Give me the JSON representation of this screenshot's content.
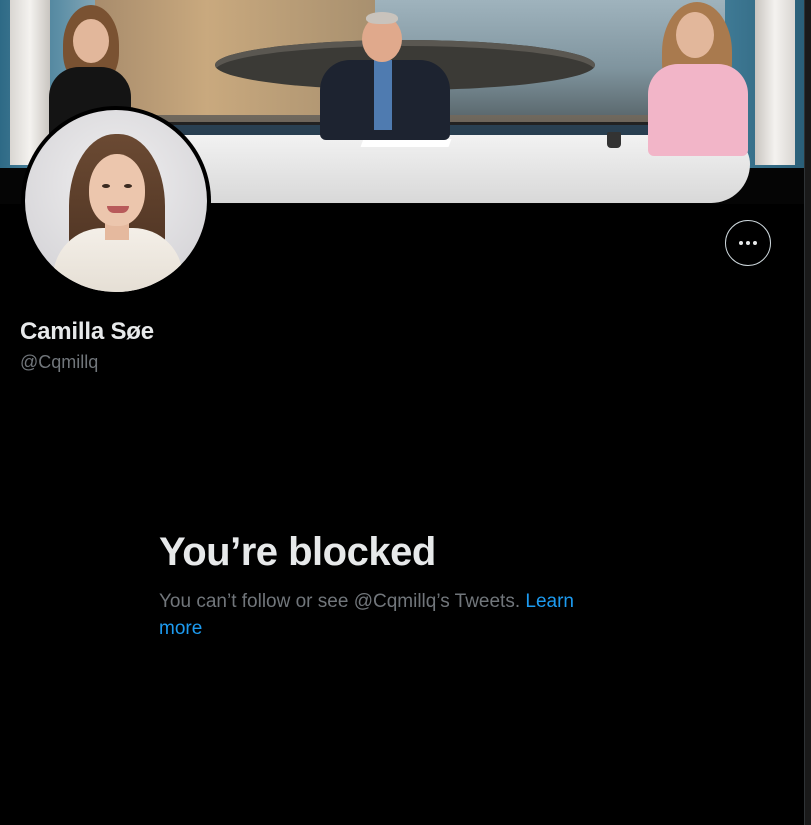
{
  "profile": {
    "display_name": "Camilla Søe",
    "handle": "@Cqmillq"
  },
  "actions": {
    "more_icon": "more-horizontal-icon"
  },
  "blocked": {
    "title": "You’re blocked",
    "message": "You can’t follow or see @Cqmillq’s Tweets.",
    "link_text": "Learn more"
  },
  "colors": {
    "background": "#000000",
    "primary_text": "#e7e9ea",
    "secondary_text": "#71767b",
    "link": "#1d9bf0"
  }
}
